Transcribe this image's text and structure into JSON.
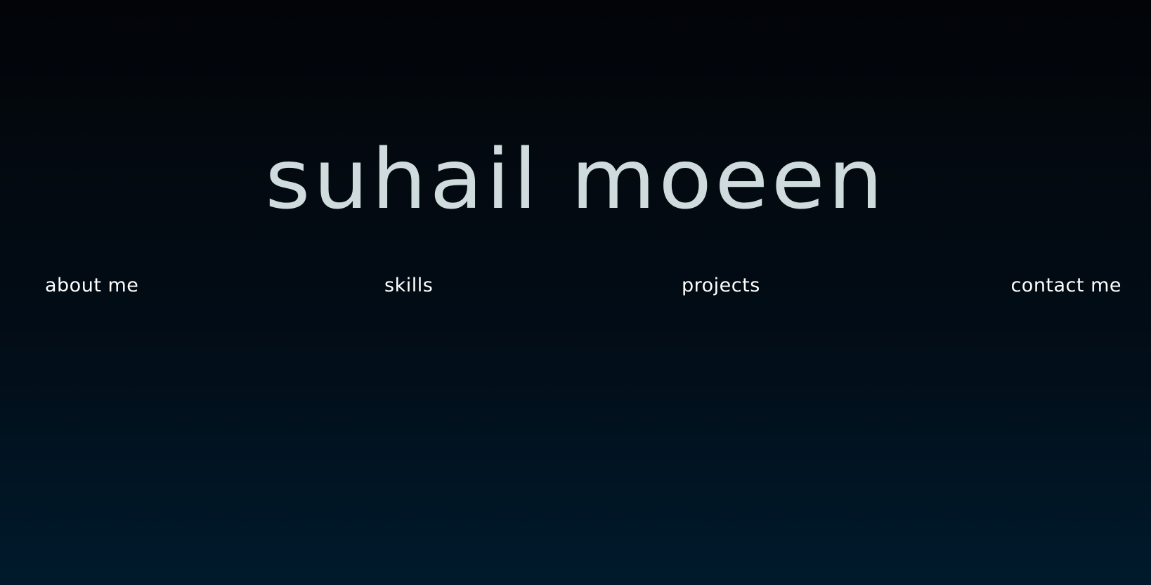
{
  "header": {
    "title": "suhail moeen"
  },
  "nav": {
    "items": [
      {
        "label": "about me"
      },
      {
        "label": "skills"
      },
      {
        "label": "projects"
      },
      {
        "label": "contact me"
      }
    ]
  },
  "colors": {
    "title": "#cfdbdc",
    "nav_text": "#ffffff",
    "background_top": "#020408",
    "background_bottom": "#001a2c"
  }
}
